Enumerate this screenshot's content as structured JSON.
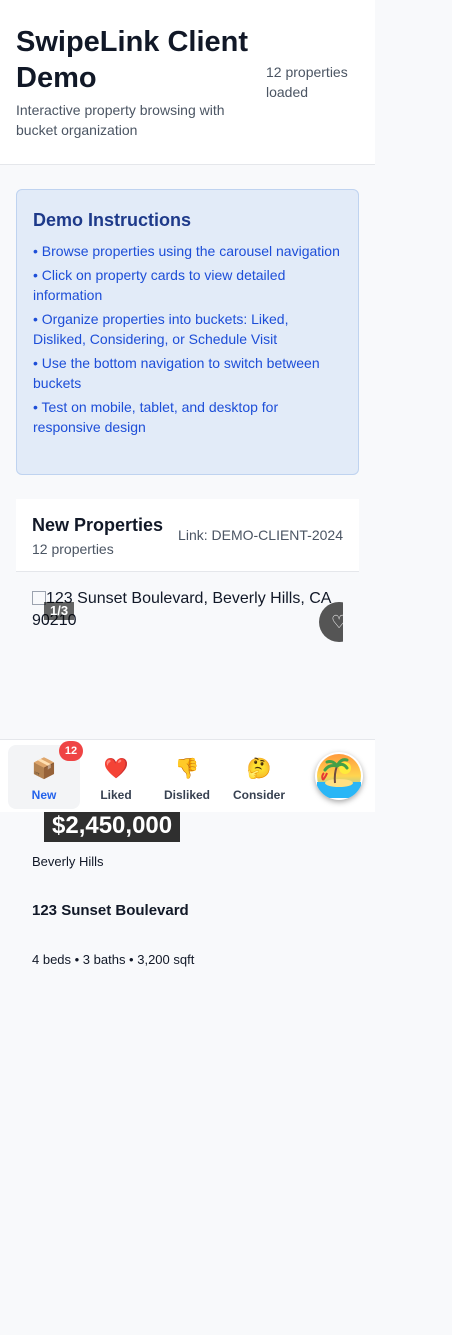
{
  "header": {
    "title": "SwipeLink Client Demo",
    "subtitle": "Interactive property browsing with bucket organization",
    "count_text": "12 properties loaded"
  },
  "instructions": {
    "title": "Demo Instructions",
    "items": [
      "• Browse properties using the carousel navigation",
      "• Click on property cards to view detailed information",
      "• Organize properties into buckets: Liked, Disliked, Considering, or Schedule Visit",
      "• Use the bottom navigation to switch between buckets",
      "• Test on mobile, tablet, and desktop for responsive design"
    ]
  },
  "section": {
    "title": "New Properties",
    "count": "12 properties",
    "link": "Link: DEMO-CLIENT-2024"
  },
  "property": {
    "image_alt": "123 Sunset Boulevard, Beverly Hills, CA 90210",
    "image_counter": "1/3",
    "price": "$2,450,000",
    "location": "Beverly Hills",
    "address": "123 Sunset Boulevard",
    "specs": "4 beds • 3 baths • 3,200 sqft",
    "favorite_icon": "heart-outline-icon"
  },
  "nav": {
    "tabs": [
      {
        "label": "New",
        "icon": "📦",
        "icon_name": "package-icon",
        "badge": "12",
        "active": true
      },
      {
        "label": "Liked",
        "icon": "❤️",
        "icon_name": "heart-icon"
      },
      {
        "label": "Disliked",
        "icon": "👎",
        "icon_name": "thumbs-down-icon"
      },
      {
        "label": "Consider",
        "icon": "🤔",
        "icon_name": "thinking-face-icon"
      }
    ],
    "fab_icon": "tropical-island-icon"
  },
  "colors": {
    "accent": "#2563eb",
    "badge": "#ef4444",
    "instructions_bg": "#e2ebf8",
    "instructions_text": "#1d4ed8"
  }
}
